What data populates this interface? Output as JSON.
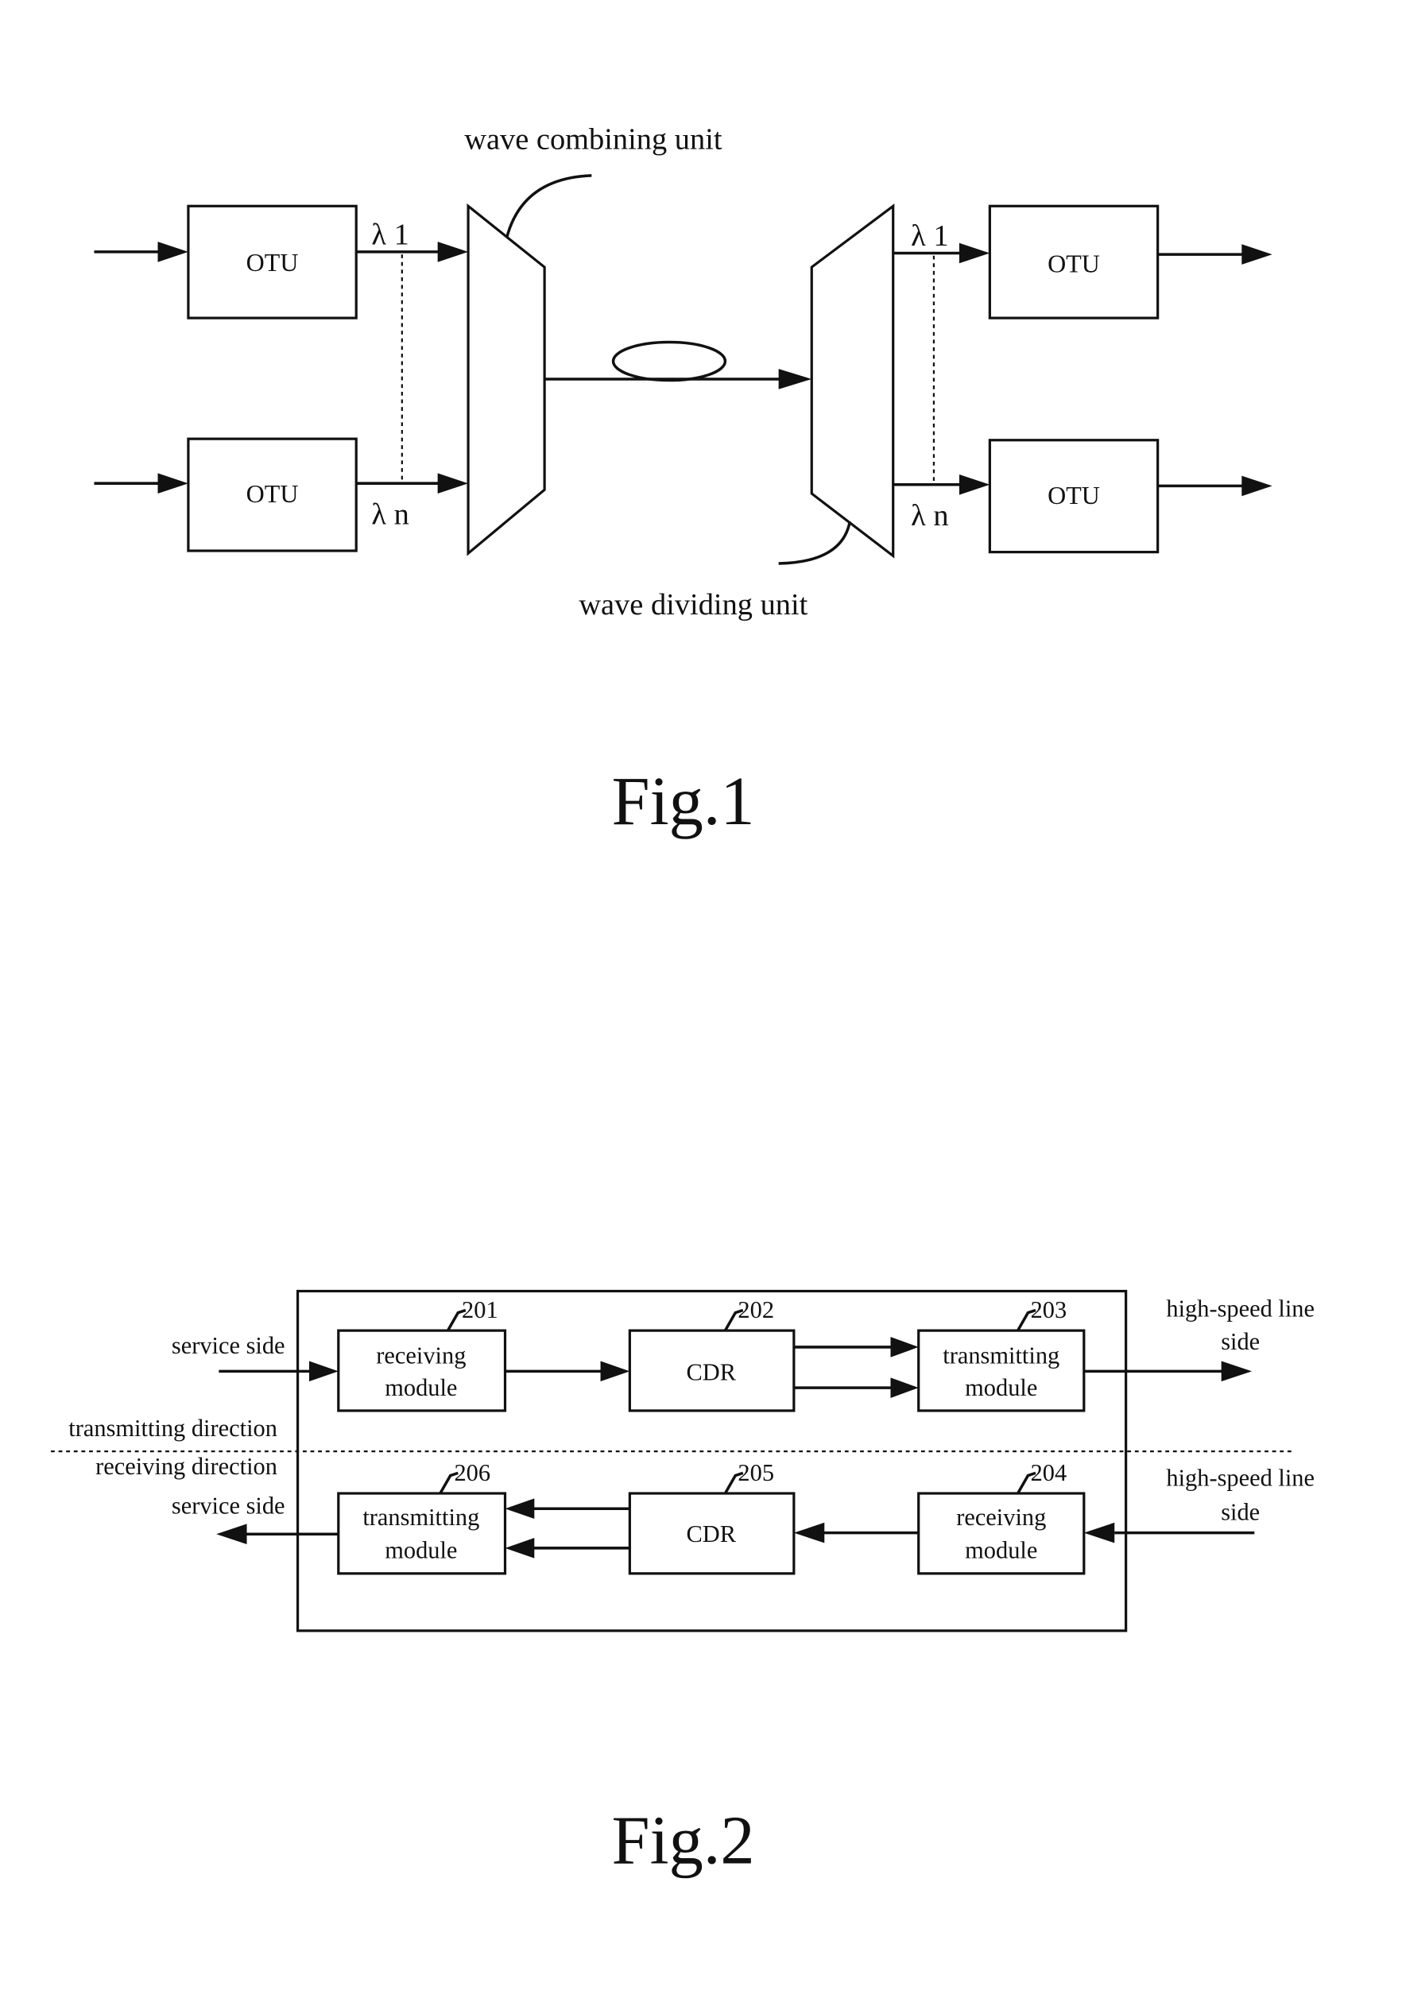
{
  "fig1": {
    "caption": "Fig.1",
    "wave_combining_label": "wave combining unit",
    "wave_dividing_label": "wave dividing unit",
    "otu_labels": [
      "OTU",
      "OTU",
      "OTU",
      "OTU"
    ],
    "lambda_labels": [
      "λ 1",
      "λ n",
      "λ 1",
      "λ n"
    ]
  },
  "fig2": {
    "caption": "Fig.2",
    "left_labels": {
      "service_side_top": "service side",
      "transmitting_direction": "transmitting direction",
      "receiving_direction": "receiving direction",
      "service_side_bottom": "service side"
    },
    "right_labels": {
      "top_line1": "high-speed line",
      "top_line2": "side",
      "bottom_line1": "high-speed line",
      "bottom_line2": "side"
    },
    "modules": [
      {
        "ref": "201",
        "line1": "receiving",
        "line2": "module"
      },
      {
        "ref": "202",
        "line1": "CDR",
        "line2": ""
      },
      {
        "ref": "203",
        "line1": "transmitting",
        "line2": "module"
      },
      {
        "ref": "204",
        "line1": "receiving",
        "line2": "module"
      },
      {
        "ref": "205",
        "line1": "CDR",
        "line2": ""
      },
      {
        "ref": "206",
        "line1": "transmitting",
        "line2": "module"
      }
    ]
  }
}
